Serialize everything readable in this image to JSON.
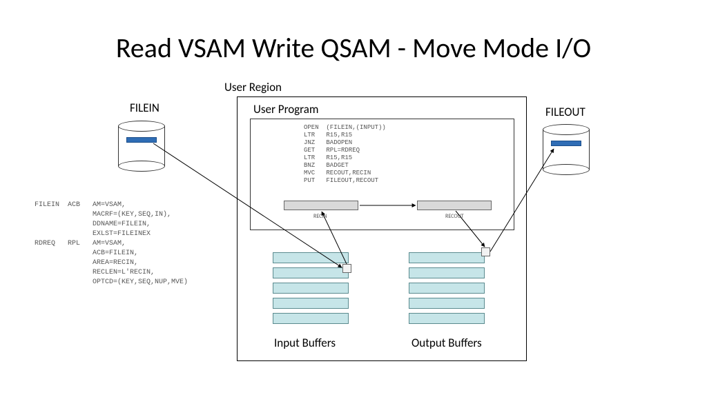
{
  "title": "Read VSAM Write QSAM - Move Mode I/O",
  "user_region_label": "User Region",
  "filein_label": "FILEIN",
  "fileout_label": "FILEOUT",
  "user_program_label": "User Program",
  "code_lines": "OPEN  (FILEIN,(INPUT))\nLTR   R15,R15\nJNZ   BADOPEN\nGET   RPL=RDREQ\nLTR   R15,R15\nBNZ   BADGET\nMVC   RECOUT,RECIN\nPUT   FILEOUT,RECOUT",
  "recin_label": "RECIN",
  "recout_label": "RECOUT",
  "input_buffers_label": "Input Buffers",
  "output_buffers_label": "Output Buffers",
  "side_code": "FILEIN  ACB   AM=VSAM,\n              MACRF=(KEY,SEQ,IN),\n              DDNAME=FILEIN,\n              EXLST=FILEINEX\nRDREQ   RPL   AM=VSAM,\n              ACB=FILEIN,\n              AREA=RECIN,\n              RECLEN=L'RECIN,\n              OPTCD=(KEY,SEQ,NUP,MVE)"
}
